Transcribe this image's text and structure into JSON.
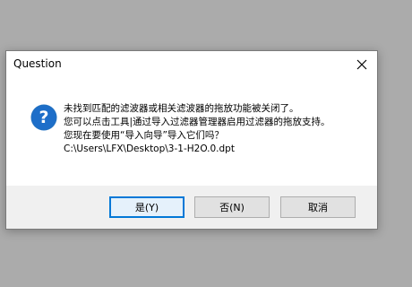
{
  "dialog": {
    "title": "Question",
    "message_lines": [
      "未找到匹配的滤波器或相关滤波器的拖放功能被关闭了。",
      "您可以点击工具|通过导入过滤器管理器启用过滤器的拖放支持。",
      "您现在要使用“导入向导”导入它们吗？",
      "C:\\Users\\LFX\\Desktop\\3-1-H2O.0.dpt"
    ],
    "buttons": {
      "yes": "是(Y)",
      "no": "否(N)",
      "cancel": "取消"
    },
    "icons": {
      "close": "close-icon",
      "question": "question-icon"
    }
  },
  "colors": {
    "background": "#ababab",
    "dialog_bg": "#ffffff",
    "footer_bg": "#f0f0f0",
    "accent": "#0078d7",
    "icon_blue": "#1f6fc2"
  }
}
